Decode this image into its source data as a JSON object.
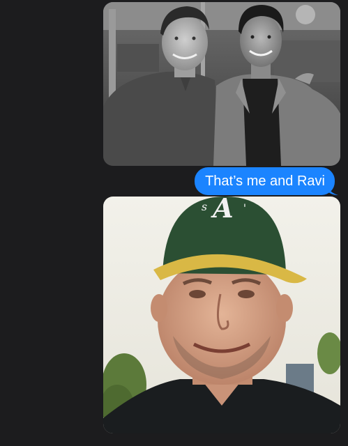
{
  "messages": {
    "sent_text": "That’s me and Ravi"
  },
  "colors": {
    "background": "#1c1c1e",
    "sent_bubble": "#1b84ff",
    "sent_text": "#ffffff"
  },
  "photos": [
    {
      "kind": "photo-attachment",
      "style": "black-and-white"
    },
    {
      "kind": "photo-attachment",
      "style": "color"
    }
  ]
}
